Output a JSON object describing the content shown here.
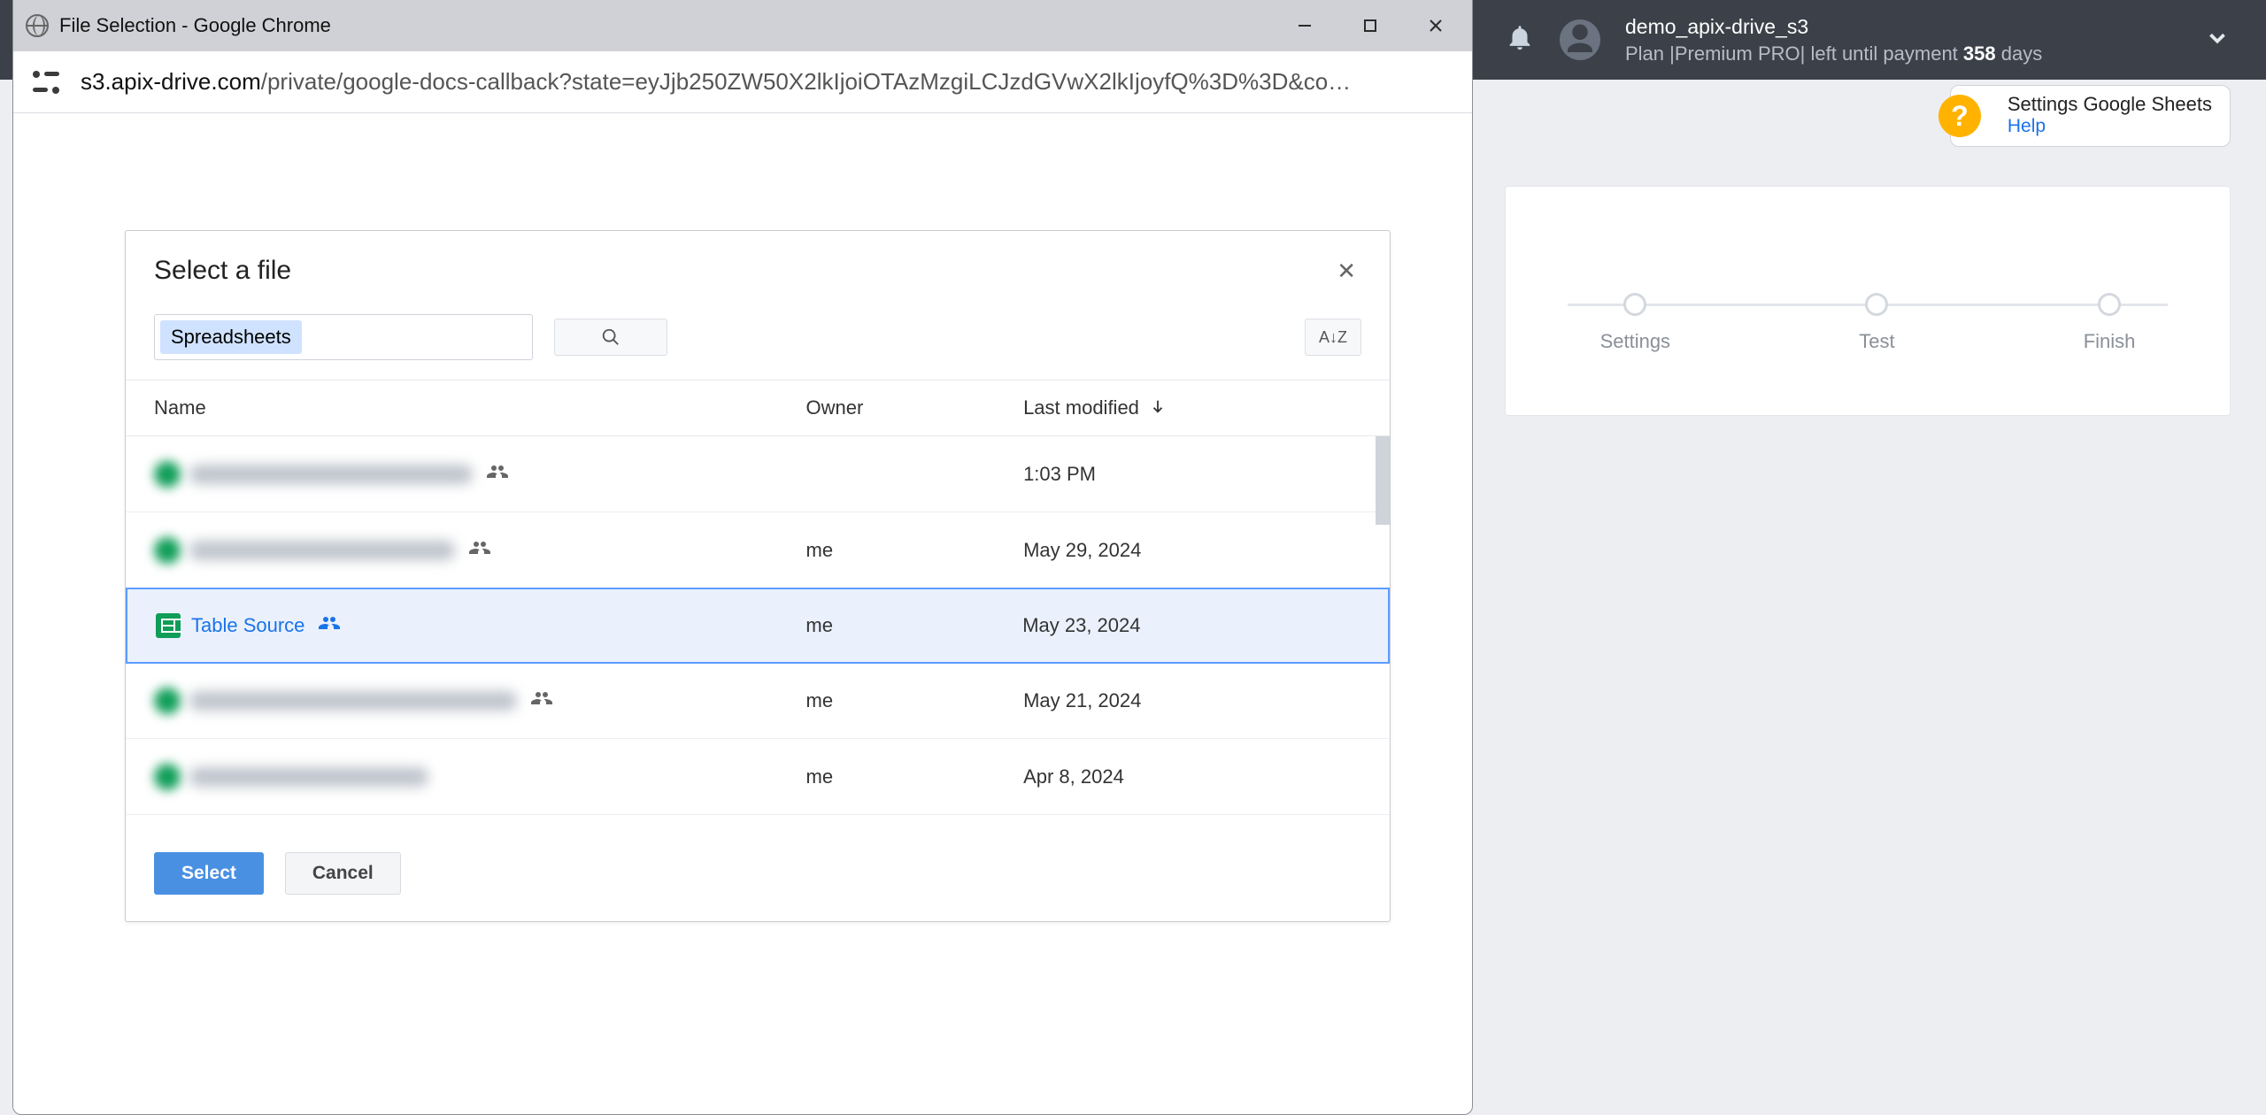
{
  "app_header": {
    "account_name": "demo_apix-drive_s3",
    "plan_prefix": "Plan |",
    "plan_name": "Premium PRO",
    "plan_mid": "| left until payment ",
    "plan_days": "358",
    "plan_suffix": " days"
  },
  "settings_bubble": {
    "title": "Settings Google Sheets",
    "help": "Help",
    "badge": "?"
  },
  "wizard": {
    "steps": [
      "Settings",
      "Test",
      "Finish"
    ]
  },
  "popup": {
    "window_title": "File Selection - Google Chrome",
    "url_domain": "s3.apix-drive.com",
    "url_path": "/private/google-docs-callback?state=eyJjb250ZW50X2lkIjoiOTAzMzgiLCJzdGVwX2lkIjoyfQ%3D%3D&co…"
  },
  "picker": {
    "title": "Select a file",
    "chip": "Spreadsheets",
    "sort_symbol": "A↓Z",
    "columns": {
      "name": "Name",
      "owner": "Owner",
      "modified": "Last modified"
    },
    "rows": [
      {
        "blurred": true,
        "owner": "",
        "modified": "1:03 PM",
        "selected": false,
        "shared": true,
        "name_width": 320
      },
      {
        "blurred": true,
        "owner": "me",
        "modified": "May 29, 2024",
        "selected": false,
        "shared": true,
        "name_width": 300
      },
      {
        "blurred": false,
        "owner": "me",
        "modified": "May 23, 2024",
        "selected": true,
        "shared": true,
        "name": "Table Source"
      },
      {
        "blurred": true,
        "owner": "me",
        "modified": "May 21, 2024",
        "selected": false,
        "shared": true,
        "name_width": 370
      },
      {
        "blurred": true,
        "owner": "me",
        "modified": "Apr 8, 2024",
        "selected": false,
        "shared": false,
        "name_width": 270
      }
    ],
    "buttons": {
      "select": "Select",
      "cancel": "Cancel"
    }
  }
}
